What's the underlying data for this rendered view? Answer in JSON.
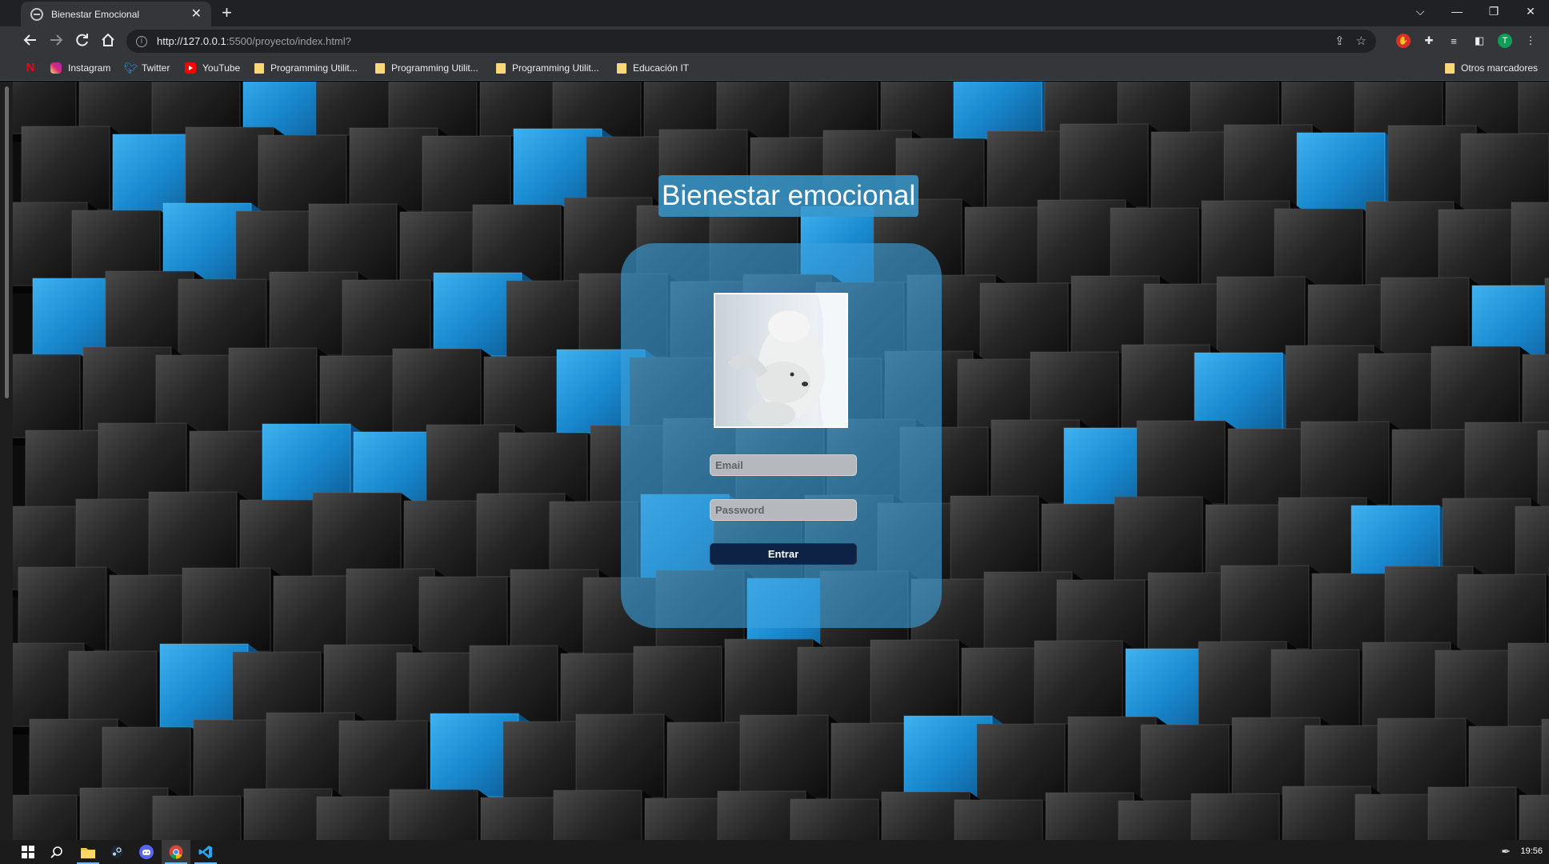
{
  "browser": {
    "tab_title": "Bienestar Emocional",
    "new_tab_symbol": "+",
    "url_host": "http://127.0.0.1",
    "url_path": ":5500/proyecto/index.html?",
    "window_controls": [
      "⌵",
      "—",
      "❐",
      "✕"
    ]
  },
  "bookmarks": [
    {
      "label": "",
      "icon": "netflix-icon"
    },
    {
      "label": "Instagram",
      "icon": "instagram-icon"
    },
    {
      "label": "Twitter",
      "icon": "twitter-icon"
    },
    {
      "label": "YouTube",
      "icon": "youtube-icon"
    },
    {
      "label": "Programming Utilit...",
      "icon": "folder-icon"
    },
    {
      "label": "Programming Utilit...",
      "icon": "folder-icon"
    },
    {
      "label": "Programming Utilit...",
      "icon": "folder-icon"
    },
    {
      "label": "Educación IT",
      "icon": "folder-icon"
    }
  ],
  "other_bookmarks": "Otros marcadores",
  "profile_initial": "T",
  "page": {
    "title": "Bienestar emocional",
    "email_placeholder": "Email",
    "password_placeholder": "Password",
    "submit_label": "Entrar"
  },
  "taskbar": {
    "clock": "19:56"
  },
  "colors": {
    "accent_blue": "#2a9ee0",
    "card": "#3ca0dc",
    "button": "#0c2346"
  }
}
